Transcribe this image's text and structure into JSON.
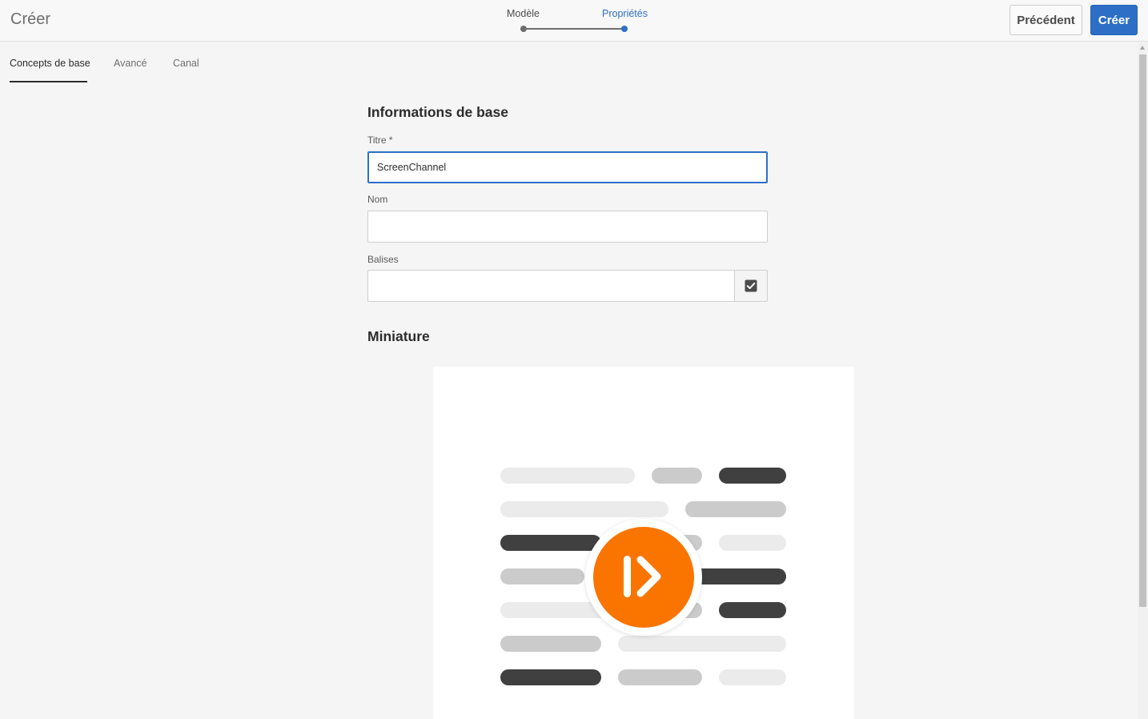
{
  "app": {
    "title": "Créer"
  },
  "wizard": {
    "steps": [
      {
        "label": "Modèle",
        "state": "completed"
      },
      {
        "label": "Propriétés",
        "state": "current"
      }
    ]
  },
  "actions": {
    "previous_label": "Précédent",
    "create_label": "Créer"
  },
  "tabs": [
    {
      "label": "Concepts de base",
      "active": true
    },
    {
      "label": "Avancé",
      "active": false
    },
    {
      "label": "Canal",
      "active": false
    }
  ],
  "form": {
    "section_title": "Informations de base",
    "title_label": "Titre *",
    "title_value": "ScreenChannel",
    "name_label": "Nom",
    "name_value": "",
    "tags_label": "Balises",
    "tags_value": "",
    "tags_picker_icon": "checkbox-checked-icon"
  },
  "thumbnail": {
    "section_title": "Miniature",
    "badge_icon": "screens-play-icon"
  },
  "colors": {
    "accent_blue": "#2d6fc6",
    "badge_orange": "#fa7500",
    "dark_gray": "#404040",
    "mid_gray": "#cbcbcb",
    "light_gray": "#ebebeb"
  }
}
